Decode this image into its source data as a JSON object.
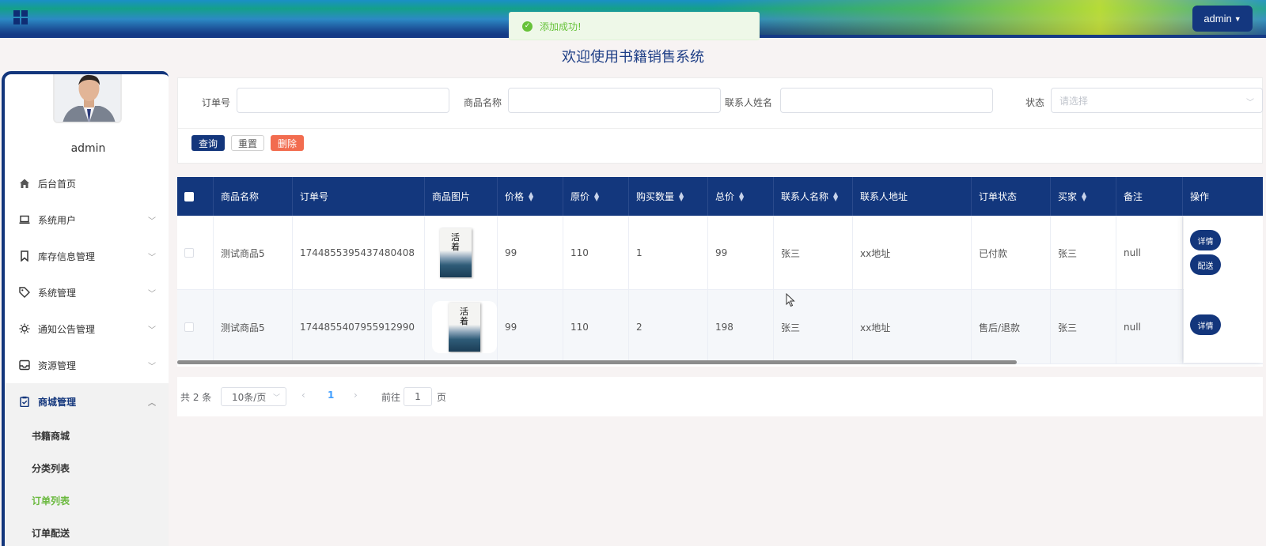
{
  "header": {
    "user_button": "admin",
    "toast": "添加成功!",
    "system_title": "欢迎使用书籍销售系统"
  },
  "sidebar": {
    "username": "admin",
    "items": [
      {
        "label": "后台首页",
        "icon": "home-icon"
      },
      {
        "label": "系统用户",
        "icon": "laptop-icon"
      },
      {
        "label": "库存信息管理",
        "icon": "bookmark-icon"
      },
      {
        "label": "系统管理",
        "icon": "tag-icon"
      },
      {
        "label": "通知公告管理",
        "icon": "sun-icon"
      },
      {
        "label": "资源管理",
        "icon": "inbox-icon"
      },
      {
        "label": "商城管理",
        "icon": "clipboard-icon"
      }
    ],
    "sub_items": [
      {
        "label": "书籍商城"
      },
      {
        "label": "分类列表"
      },
      {
        "label": "订单列表"
      },
      {
        "label": "订单配送"
      }
    ]
  },
  "search": {
    "order_no_label": "订单号",
    "product_name_label": "商品名称",
    "contact_name_label": "联系人姓名",
    "status_label": "状态",
    "status_placeholder": "请选择",
    "query_btn": "查询",
    "reset_btn": "重置",
    "delete_btn": "删除"
  },
  "table": {
    "headers": [
      "商品名称",
      "订单号",
      "商品图片",
      "价格",
      "原价",
      "购买数量",
      "总价",
      "联系人名称",
      "联系人地址",
      "订单状态",
      "买家",
      "备注",
      "操作"
    ],
    "rows": [
      {
        "name": "测试商品5",
        "order_no": "1744855395437480408",
        "price": "99",
        "orig_price": "110",
        "qty": "1",
        "total": "99",
        "contact": "张三",
        "address": "xx地址",
        "status": "已付款",
        "buyer": "张三",
        "note": "null"
      },
      {
        "name": "测试商品5",
        "order_no": "1744855407955912990",
        "price": "99",
        "orig_price": "110",
        "qty": "2",
        "total": "198",
        "contact": "张三",
        "address": "xx地址",
        "status": "售后/退款",
        "buyer": "张三",
        "note": "null"
      }
    ],
    "book_title": "活着",
    "detail_btn": "详情",
    "deliver_btn": "配送"
  },
  "pager": {
    "total": "共 2 条",
    "page_size": "10条/页",
    "current_page": "1",
    "goto_label": "前往",
    "goto_value": "1",
    "page_suffix": "页"
  },
  "colors": {
    "primary": "#13367c",
    "success": "#67c23a",
    "danger": "#f26c4f",
    "active_sub": "#6bb93f"
  }
}
